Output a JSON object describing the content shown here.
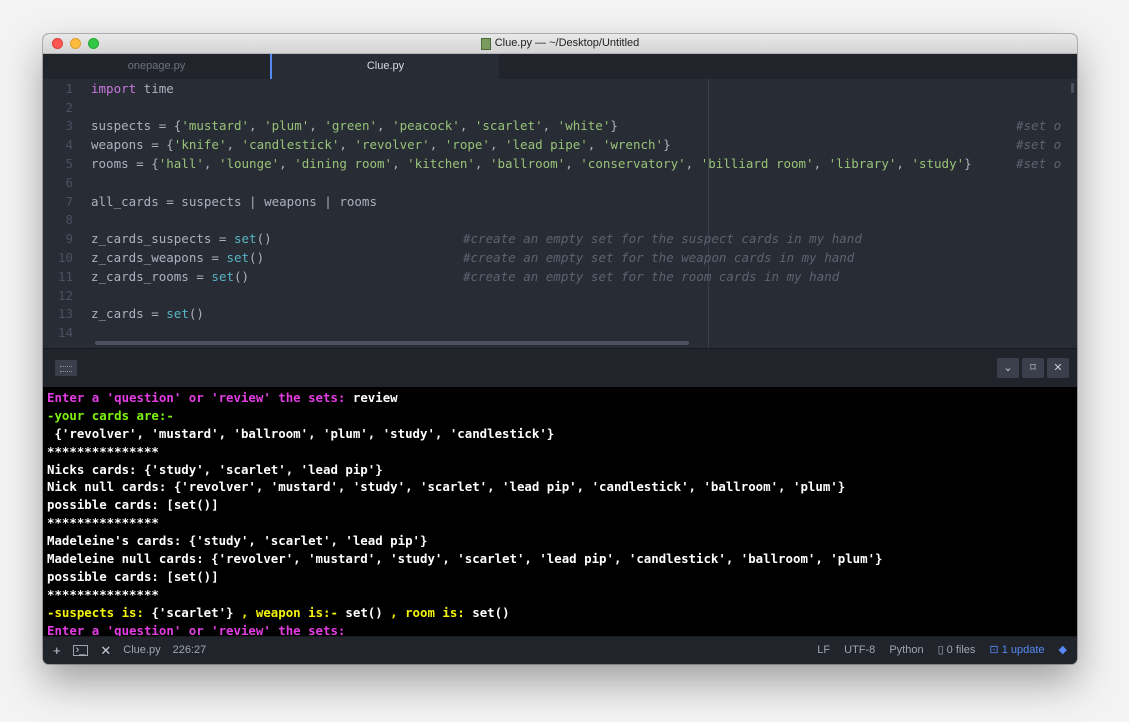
{
  "window": {
    "title": "Clue.py — ~/Desktop/Untitled"
  },
  "tabs": [
    {
      "label": "onepage.py"
    },
    {
      "label": "Clue.py"
    }
  ],
  "editor": {
    "line_numbers": [
      "1",
      "2",
      "3",
      "4",
      "5",
      "6",
      "7",
      "8",
      "9",
      "10",
      "11",
      "12",
      "13",
      "14"
    ],
    "lines": {
      "l1": {
        "kw": "import",
        "rest": " time"
      },
      "l3": {
        "a": "suspects = {",
        "s1": "'mustard'",
        "s2": "'plum'",
        "s3": "'green'",
        "s4": "'peacock'",
        "s5": "'scarlet'",
        "s6": "'white'",
        "end": "}",
        "comment": "#set o"
      },
      "l4": {
        "a": "weapons = {",
        "s1": "'knife'",
        "s2": "'candlestick'",
        "s3": "'revolver'",
        "s4": "'rope'",
        "s5": "'lead pipe'",
        "s6": "'wrench'",
        "end": "}",
        "comment": "#set o"
      },
      "l5": {
        "a": "rooms = {",
        "s1": "'hall'",
        "s2": "'lounge'",
        "s3": "'dining room'",
        "s4": "'kitchen'",
        "s5": "'ballroom'",
        "s6": "'conservatory'",
        "s7": "'billiard room'",
        "s8": "'library'",
        "s9": "'study'",
        "end": "}",
        "comment": "#set o"
      },
      "l7": {
        "text": "all_cards = suspects | weapons | rooms"
      },
      "l9": {
        "a": "z_cards_suspects = ",
        "fn": "set",
        "b": "()",
        "comment": "#create an empty set for the suspect cards in my hand"
      },
      "l10": {
        "a": "z_cards_weapons = ",
        "fn": "set",
        "b": "()",
        "comment": "#create an empty set for the weapon cards in my hand"
      },
      "l11": {
        "a": "z_cards_rooms = ",
        "fn": "set",
        "b": "()",
        "comment": "#create an empty set for the room cards in my hand"
      },
      "l13": {
        "a": "z_cards = ",
        "fn": "set",
        "b": "()"
      }
    },
    "sep": ", "
  },
  "terminal": {
    "prompt": "Enter a 'question' or 'review' the sets:",
    "input": " review",
    "your_cards": "-your cards are:-",
    "lines": [
      " {'revolver', 'mustard', 'ballroom', 'plum', 'study', 'candlestick'}",
      "***************",
      "Nicks cards: {'study', 'scarlet', 'lead pip'}",
      "Nick null cards: {'revolver', 'mustard', 'study', 'scarlet', 'lead pip', 'candlestick', 'ballroom', 'plum'}",
      "possible cards: [set()]",
      "***************",
      "Madeleine's cards: {'study', 'scarlet', 'lead pip'}",
      "Madeleine null cards: {'revolver', 'mustard', 'study', 'scarlet', 'lead pip', 'candlestick', 'ballroom', 'plum'}",
      "possible cards: [set()]",
      "***************"
    ],
    "result": {
      "suspects_label": "-suspects is:",
      "suspects_val": " {'scarlet'} ",
      "weapon_label": ", weapon is:-",
      "weapon_val": " set() ",
      "room_label": ", room is:",
      "room_val": " set()"
    },
    "final_prompt": "Enter a 'question' or 'review' the sets:"
  },
  "statusbar": {
    "file": "Clue.py",
    "position": "226:27",
    "line_ending": "LF",
    "encoding": "UTF-8",
    "grammar": "Python",
    "files": "0 files",
    "update": "1 update"
  },
  "colors": {
    "accent": "#568af2",
    "keyword": "#c678dd",
    "string": "#98c379",
    "terminal_magenta": "#e33de3",
    "terminal_green": "#7cf30a",
    "terminal_yellow": "#f3f30a"
  }
}
